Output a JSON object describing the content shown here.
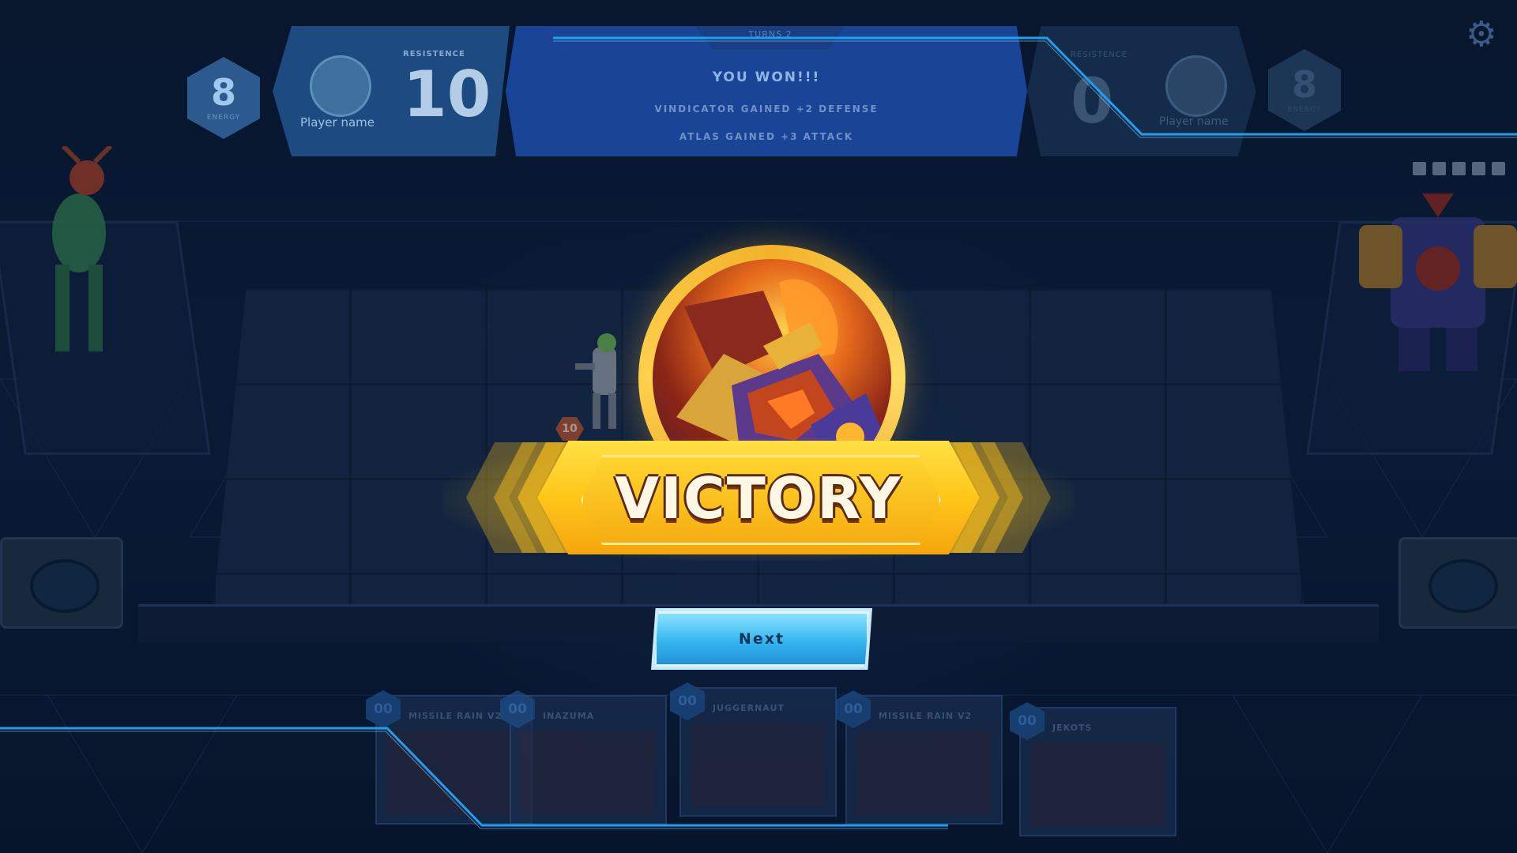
{
  "hud": {
    "player": {
      "energy": "8",
      "energy_label": "ENERGY",
      "name": "Player name",
      "resistance_label": "RESISTENCE",
      "resistance": "10"
    },
    "message": {
      "turn": "TURNS 2",
      "title": "YOU WON!!!",
      "line1": "VINDICATOR GAINED +2 DEFENSE",
      "line2": "ATLAS GAINED +3 ATTACK"
    },
    "opponent": {
      "energy": "8",
      "energy_label": "ENERGY",
      "name": "Player name",
      "resistance_label": "RESISTENCE",
      "resistance": "0"
    }
  },
  "board": {
    "unit_badge": "10"
  },
  "result": {
    "title": "VICTORY",
    "next_label": "Next"
  },
  "hand": [
    {
      "cost": "00",
      "name": "MISSILE RAIN V2"
    },
    {
      "cost": "00",
      "name": "INAZUMA"
    },
    {
      "cost": "00",
      "name": "JUGGERNAUT"
    },
    {
      "cost": "00",
      "name": "MISSILE RAIN V2"
    },
    {
      "cost": "00",
      "name": "JEKOTS"
    }
  ],
  "icons": {
    "settings": "gear-icon"
  },
  "colors": {
    "victory_gold": "#ffc61a",
    "next_button": "#35b6ef",
    "frame_cyan": "#1e9ff0",
    "background": "#0a1a33"
  }
}
